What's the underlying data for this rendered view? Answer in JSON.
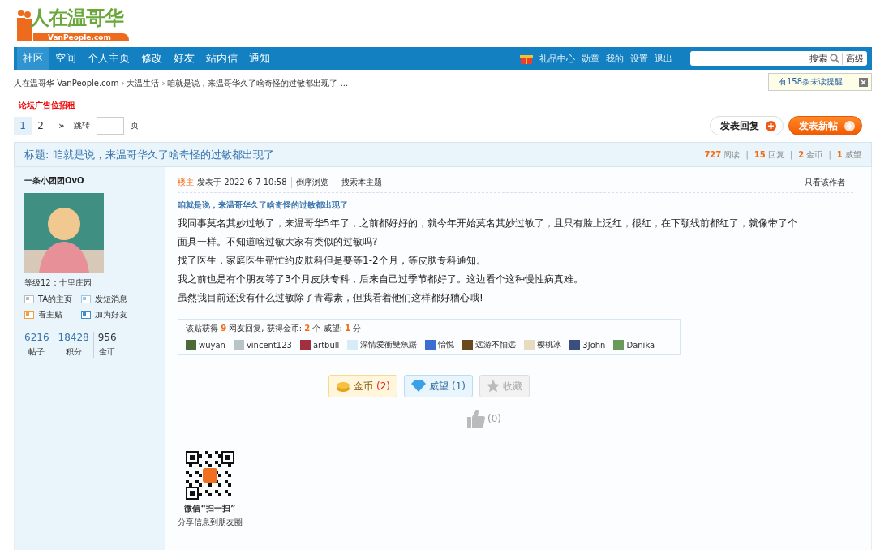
{
  "logo": {
    "title": "人在温哥华",
    "subtitle": "VanPeople.com"
  },
  "nav": {
    "items": [
      {
        "label": "社区",
        "selected": true
      },
      {
        "label": "空间",
        "selected": false
      },
      {
        "label": "个人主页",
        "selected": false
      },
      {
        "label": "修改",
        "selected": false
      },
      {
        "label": "好友",
        "selected": false
      },
      {
        "label": "站内信",
        "selected": false
      },
      {
        "label": "通知",
        "selected": false
      }
    ],
    "user_links": [
      "礼品中心",
      "勋章",
      "我的",
      "设置",
      "退出"
    ],
    "search": {
      "button": "搜索",
      "advanced": "高级"
    }
  },
  "breadcrumb_separator": "›",
  "breadcrumb": [
    "人在温哥华 VanPeople.com",
    "大温生活",
    "咱就是说，来温哥华久了啥奇怪的过敏都出现了 ..."
  ],
  "notice": {
    "text": "有158条未读提醒"
  },
  "ad_link": "论坛广告位招租",
  "pagination": {
    "pages": [
      {
        "label": "1",
        "selected": true
      },
      {
        "label": "2",
        "selected": false
      }
    ],
    "next": "»",
    "jump_label": "跳转",
    "page_suffix": "页"
  },
  "actions": [
    {
      "label": "发表回复",
      "kind": "reply"
    },
    {
      "label": "发表新帖",
      "kind": "new"
    }
  ],
  "thread": {
    "title": "标题: 咱就是说，来温哥华久了啥奇怪的过敏都出现了",
    "separator": "|",
    "stats": [
      "**727** 阅读",
      "**15** 回复",
      "**2** 金币",
      "**1** 威望"
    ]
  },
  "author": {
    "name": "一条小团团OvO",
    "level": "等级12：十里庄园",
    "links": [
      {
        "label": "TA的主页",
        "kind": "home"
      },
      {
        "label": "发短消息",
        "kind": "message"
      },
      {
        "label": "看主贴",
        "kind": "posts"
      },
      {
        "label": "加为好友",
        "kind": "friend"
      }
    ],
    "stats": [
      {
        "value": "6216",
        "label": "帖子",
        "link": true
      },
      {
        "value": "18428",
        "label": "积分",
        "link": true
      },
      {
        "value": "956",
        "label": "金币",
        "link": false
      }
    ]
  },
  "post": {
    "floor": "楼主",
    "posted": "发表于 2022-6-7 10:58",
    "tools": [
      "倒序浏览",
      "搜索本主题"
    ],
    "only_author": "只看该作者",
    "subject": "咱就是说，来温哥华久了啥奇怪的过敏都出现了",
    "paragraphs": [
      "我同事莫名其妙过敏了，来温哥华5年了，之前都好好的，就今年开始莫名其妙过敏了，且只有脸上泛红，很红，在下颚线前都红了，就像带了个面具一样。不知道啥过敏大家有类似的过敏吗?",
      "找了医生，家庭医生帮忙约皮肤科但是要等1-2个月，等皮肤专科通知。",
      "我之前也是有个朋友等了3个月皮肤专科，后来自己过季节都好了。这边看个这种慢性病真难。",
      "虽然我目前还没有什么过敏除了青霉素，但我看着他们这样都好糟心哦!"
    ],
    "rating": {
      "summary": "该贴获得 **9** 网友回复, 获得金币: **2** 个 威望: **1** 分",
      "users": [
        {
          "name": "wuyan",
          "color": "#4a6a3a"
        },
        {
          "name": "vincent123",
          "color": "#b8c4c8"
        },
        {
          "name": "artbull",
          "color": "#a03040"
        },
        {
          "name": "深情爱衝雙魚踞",
          "color": "#d6ecf6"
        },
        {
          "name": "怡悦",
          "color": "#3a6fd0"
        },
        {
          "name": "远游不怕远",
          "color": "#6a4a1a"
        },
        {
          "name": "樱桃冰",
          "color": "#e8dcc0"
        },
        {
          "name": "3John",
          "color": "#3a4f80"
        },
        {
          "name": "Danika",
          "color": "#6a9a5a"
        }
      ]
    },
    "buttons": [
      {
        "label": "金币",
        "count": "(2)",
        "kind": "coin"
      },
      {
        "label": "威望",
        "count": "(1)",
        "kind": "prestige"
      },
      {
        "label": "收藏",
        "kind": "favorite",
        "disabled": true
      }
    ],
    "like": "(0)",
    "share": {
      "title": "微信“扫一扫”",
      "subtitle": "分享信息到朋友圈"
    }
  }
}
